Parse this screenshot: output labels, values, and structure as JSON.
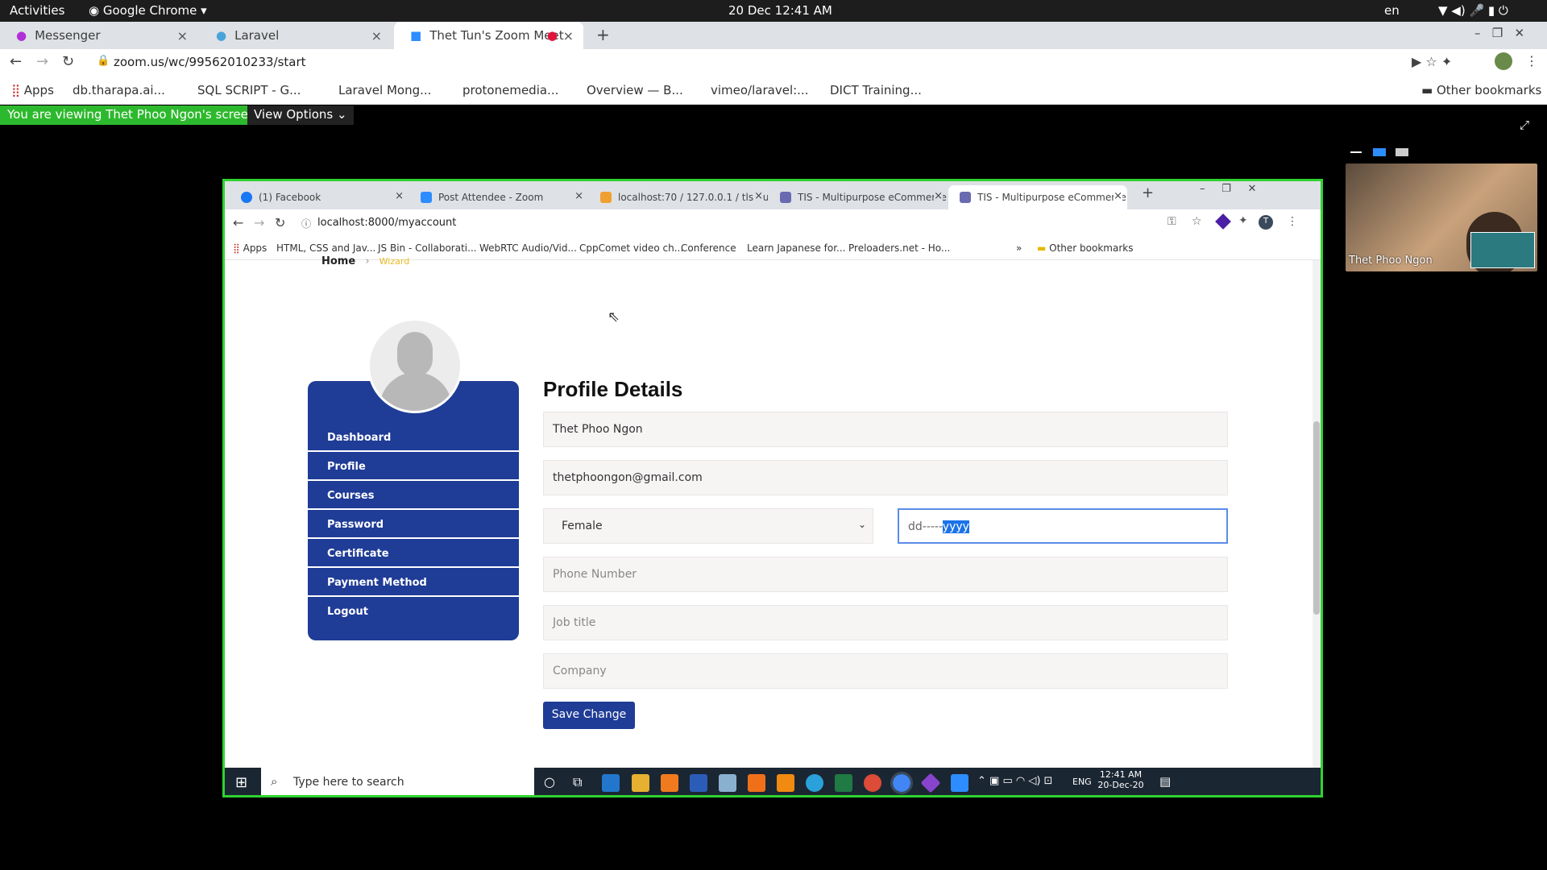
{
  "gnome": {
    "activities": "Activities",
    "app": "Google Chrome",
    "clock": "20 Dec  12:41 AM",
    "lang": "en"
  },
  "outer_tabs": [
    {
      "label": "Messenger"
    },
    {
      "label": "Laravel"
    },
    {
      "label": "Thet Tun's Zoom Meet"
    }
  ],
  "outer_url": "zoom.us/wc/99562010233/start",
  "outer_bookmarks": [
    "Apps",
    "db.tharapa.ai...",
    "SQL SCRIPT - G...",
    "Laravel Mong...",
    "protonemedia...",
    "Overview — B...",
    "vimeo/laravel:...",
    "DICT Training..."
  ],
  "outer_other_bookmarks": "Other bookmarks",
  "zoom": {
    "banner": "You are viewing Thet Phoo Ngon's screen",
    "view_options": "View Options",
    "participant": "Thet Phoo Ngon"
  },
  "inner_tabs": [
    {
      "label": "(1) Facebook"
    },
    {
      "label": "Post Attendee - Zoom"
    },
    {
      "label": "localhost:70 / 127.0.0.1 / tls / u"
    },
    {
      "label": "TIS - Multipurpose eCommerce"
    },
    {
      "label": "TIS - Multipurpose eCommerce"
    }
  ],
  "inner_url": "localhost:8000/myaccount",
  "inner_bookmarks": [
    "Apps",
    "HTML, CSS and Jav...",
    "JS Bin - Collaborati...",
    "WebRTC Audio/Vid...",
    "CppComet video ch...",
    "Conference",
    "Learn Japanese for...",
    "Preloaders.net - Ho..."
  ],
  "inner_other_bookmarks": "Other bookmarks",
  "breadcrumb": {
    "home": "Home",
    "current": "Wizard"
  },
  "menu": [
    "Dashboard",
    "Profile",
    "Courses",
    "Password",
    "Certificate",
    "Payment Method",
    "Logout"
  ],
  "form": {
    "title": "Profile Details",
    "name": "Thet Phoo Ngon",
    "email": "thetphoongon@gmail.com",
    "gender": "Female",
    "dob_prefix": "dd-----",
    "dob_selected": "yyyy",
    "phone_placeholder": "Phone Number",
    "job_placeholder": "Job title",
    "company_placeholder": "Company",
    "save": "Save Change"
  },
  "taskbar": {
    "search": "Type here to search",
    "lang": "ENG",
    "time": "12:41 AM",
    "date": "20-Dec-20"
  }
}
